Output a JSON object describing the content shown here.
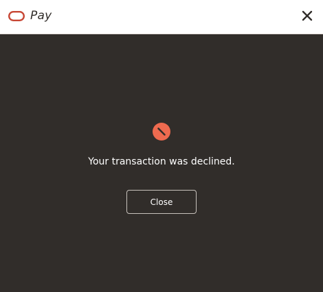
{
  "header": {
    "brand_text": "Pay",
    "logo_icon": "oracle-logo-icon",
    "close_icon": "close-icon",
    "brand_color": "#c74634"
  },
  "result": {
    "status_icon": "declined-icon",
    "status_color": "#ee6a4f",
    "message": "Your transaction was declined.",
    "close_button_label": "Close"
  },
  "colors": {
    "background": "#312d2a",
    "header_background": "#ffffff",
    "text": "#ffffff"
  }
}
